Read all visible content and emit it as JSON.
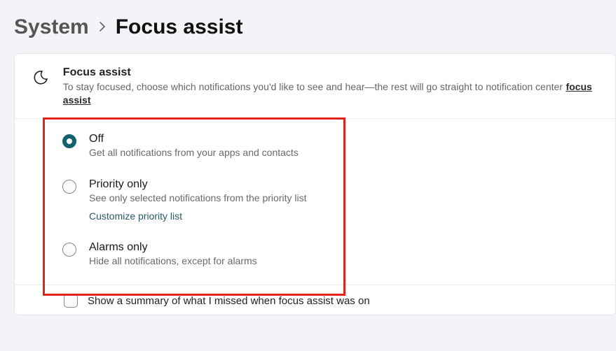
{
  "breadcrumb": {
    "parent": "System",
    "current": "Focus assist"
  },
  "header": {
    "title": "Focus assist",
    "subtitle": "To stay focused, choose which notifications you'd like to see and hear—the rest will go straight to notification center",
    "link_text": "focus assist"
  },
  "options": [
    {
      "id": "off",
      "label": "Off",
      "desc": "Get all notifications from your apps and contacts",
      "selected": true
    },
    {
      "id": "priority",
      "label": "Priority only",
      "desc": "See only selected notifications from the priority list",
      "sublink": "Customize priority list",
      "selected": false
    },
    {
      "id": "alarms",
      "label": "Alarms only",
      "desc": "Hide all notifications, except for alarms",
      "selected": false
    }
  ],
  "summary_checkbox": {
    "label": "Show a summary of what I missed when focus assist was on",
    "checked": false
  }
}
